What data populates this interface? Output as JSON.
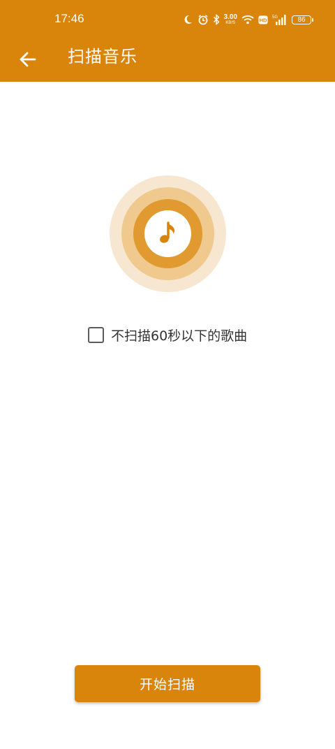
{
  "status_bar": {
    "time": "17:46",
    "speed_value": "3.00",
    "speed_unit": "KB/S",
    "hd_label": "HD",
    "network_label": "5G",
    "battery": "86",
    "icons": [
      "moon-icon",
      "alarm-icon",
      "bluetooth-icon",
      "wifi-icon",
      "hd-icon",
      "signal-icon",
      "battery-icon"
    ]
  },
  "app_bar": {
    "title": "扫描音乐",
    "back_icon": "arrow-left-icon"
  },
  "main": {
    "center_icon": "music-note-icon",
    "option_label": "不扫描60秒以下的歌曲",
    "option_checked": false
  },
  "footer": {
    "start_button_label": "开始扫描"
  },
  "colors": {
    "primary": "#d9840a",
    "ring_outer": "#f7e6d0",
    "ring_middle": "#efc98d",
    "ring_inner": "#e09a30"
  }
}
